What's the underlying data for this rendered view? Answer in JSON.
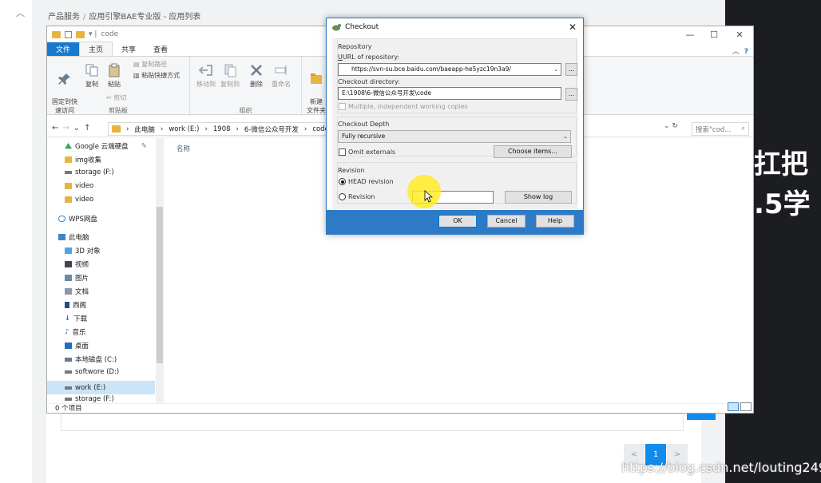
{
  "background": {
    "breadcrumb": [
      "产品服务",
      "应用引擎BAE专业版 - 应用列表"
    ],
    "pager": {
      "prev": "<",
      "current": "1",
      "next": ">"
    },
    "overlay_text": [
      "扛把",
      ".5学"
    ],
    "watermark": "https://blog.csdn.net/louting249"
  },
  "explorer": {
    "title_path": "code",
    "window_buttons": [
      "—",
      "☐",
      "✕"
    ],
    "tabs": [
      "文件",
      "主页",
      "共享",
      "查看"
    ],
    "ribbon": {
      "clipboard": {
        "label": "剪贴板",
        "pin": "固定到快\n速访问",
        "copy": "复制",
        "paste": "粘贴",
        "copy_path": "复制路径",
        "paste_shortcut": "粘贴快捷方式",
        "cut": "剪切"
      },
      "organize": {
        "label": "组织",
        "move_to": "移动到",
        "copy_to": "复制到",
        "delete": "删除",
        "rename": "重命名"
      },
      "new": {
        "new_folder": "新建\n文件夹"
      }
    },
    "address": {
      "segments": [
        "此电脑",
        "work (E:)",
        "1908",
        "6-微信公众号开发",
        "code"
      ],
      "search_placeholder": "搜索\"cod..."
    },
    "nav": [
      {
        "label": "Google 云端硬盘",
        "icon": "google-drive-icon"
      },
      {
        "label": "img收集",
        "icon": "folder-icon"
      },
      {
        "label": "storage (F:)",
        "icon": "drive-icon"
      },
      {
        "label": "video",
        "icon": "folder-icon"
      },
      {
        "label": "video",
        "icon": "folder-icon"
      },
      {
        "label": "WPS网盘",
        "icon": "cloud-icon"
      },
      {
        "label": "此电脑",
        "icon": "computer-icon"
      },
      {
        "label": "3D 对象",
        "icon": "3d-objects-icon"
      },
      {
        "label": "视频",
        "icon": "videos-icon"
      },
      {
        "label": "图片",
        "icon": "pictures-icon"
      },
      {
        "label": "文档",
        "icon": "documents-icon"
      },
      {
        "label": "西阁",
        "icon": "phone-icon"
      },
      {
        "label": "下载",
        "icon": "download-icon"
      },
      {
        "label": "音乐",
        "icon": "music-icon"
      },
      {
        "label": "桌面",
        "icon": "desktop-icon"
      },
      {
        "label": "本地磁盘 (C:)",
        "icon": "drive-icon"
      },
      {
        "label": "softwore (D:)",
        "icon": "drive-icon"
      },
      {
        "label": "work (E:)",
        "icon": "drive-icon"
      },
      {
        "label": "storage (F:)",
        "icon": "drive-icon"
      }
    ],
    "column_header": "名称",
    "status": "0 个项目"
  },
  "dialog": {
    "title": "Checkout",
    "repository_label": "Repository",
    "url_label": "URL of repository:",
    "url_value": "https://svn-su.bce.baidu.com/baeapp-he5yzc19n3a9/",
    "checkout_dir_label": "Checkout directory:",
    "checkout_dir_value": "E:\\1908\\6-微信公众号开发\\code",
    "browse_label": "...",
    "multiple_wc": "Multiple, independent working copies",
    "depth_label": "Checkout Depth",
    "depth_value": "Fully recursive",
    "omit_externals": "Omit externals",
    "choose_items": "Choose items...",
    "revision_label": "Revision",
    "head_revision": "HEAD revision",
    "revision_radio": "Revision",
    "revision_value": "",
    "show_log": "Show log",
    "ok": "OK",
    "cancel": "Cancel",
    "help": "Help"
  },
  "colors": {
    "accent": "#1979ca",
    "dialog_footer": "#2d7bc6",
    "pager_active": "#108cee",
    "cursor_highlight": "#ffec1e",
    "folder": "#e8b33e"
  }
}
